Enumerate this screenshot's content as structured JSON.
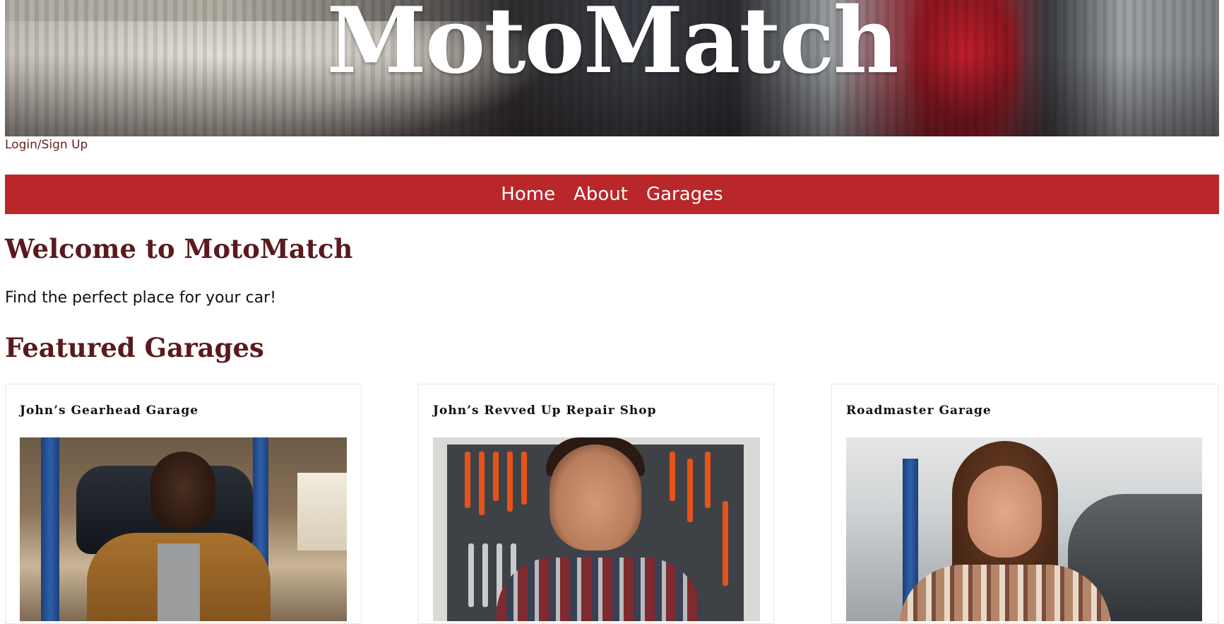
{
  "header": {
    "site_title": "MotoMatch",
    "login_link": "Login/Sign Up"
  },
  "nav": {
    "items": [
      {
        "label": "Home"
      },
      {
        "label": "About"
      },
      {
        "label": "Garages"
      }
    ]
  },
  "main": {
    "welcome_heading": "Welcome to MotoMatch",
    "tagline": "Find the perfect place for your car!",
    "featured_heading": "Featured Garages",
    "garages": [
      {
        "name": "John’s Gearhead Garage"
      },
      {
        "name": "John’s Revved Up Repair Shop"
      },
      {
        "name": "Roadmaster Garage"
      }
    ]
  },
  "colors": {
    "nav_background": "#b9272a",
    "heading_color": "#5a1a1d",
    "link_color": "#6b1e22"
  }
}
